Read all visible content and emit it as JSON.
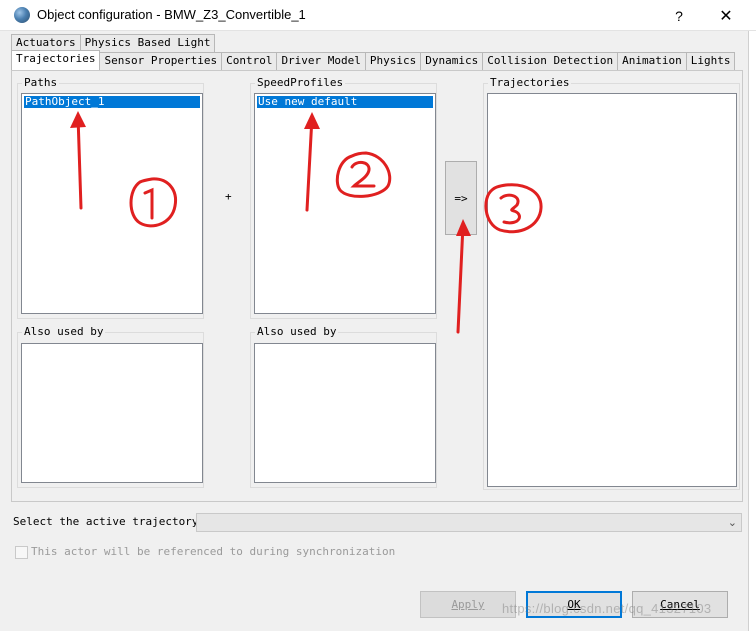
{
  "window": {
    "title": "Object configuration - BMW_Z3_Convertible_1",
    "help_label": "?",
    "close_label": "✕"
  },
  "tabs_row1": [
    "Actuators",
    "Physics Based Light"
  ],
  "tabs_row2": [
    "Trajectories",
    "Sensor Properties",
    "Control",
    "Driver Model",
    "Physics",
    "Dynamics",
    "Collision Detection",
    "Animation",
    "Lights"
  ],
  "active_tab": "Trajectories",
  "paths": {
    "title": "Paths",
    "items": [
      "PathObject_1"
    ],
    "also_used_by": "Also used by"
  },
  "speed_profiles": {
    "title": "SpeedProfiles",
    "items": [
      "Use new default"
    ],
    "also_used_by": "Also used by"
  },
  "plus_label": "+",
  "combine_button": "=>",
  "trajectories": {
    "title": "Trajectories"
  },
  "select_label": "Select the active trajectory:",
  "select_value": "",
  "sync_checkbox": {
    "label": "This actor will be referenced to during synchronization",
    "checked": false
  },
  "buttons": {
    "apply": "Apply",
    "ok": "OK",
    "cancel": "Cancel"
  },
  "watermark": "https://blog.csdn.net/qq_41327103",
  "annotations": [
    "1",
    "2",
    "3"
  ],
  "colors": {
    "selection": "#0078d7",
    "annotation": "#e02020",
    "ok_border": "#0078d7"
  }
}
